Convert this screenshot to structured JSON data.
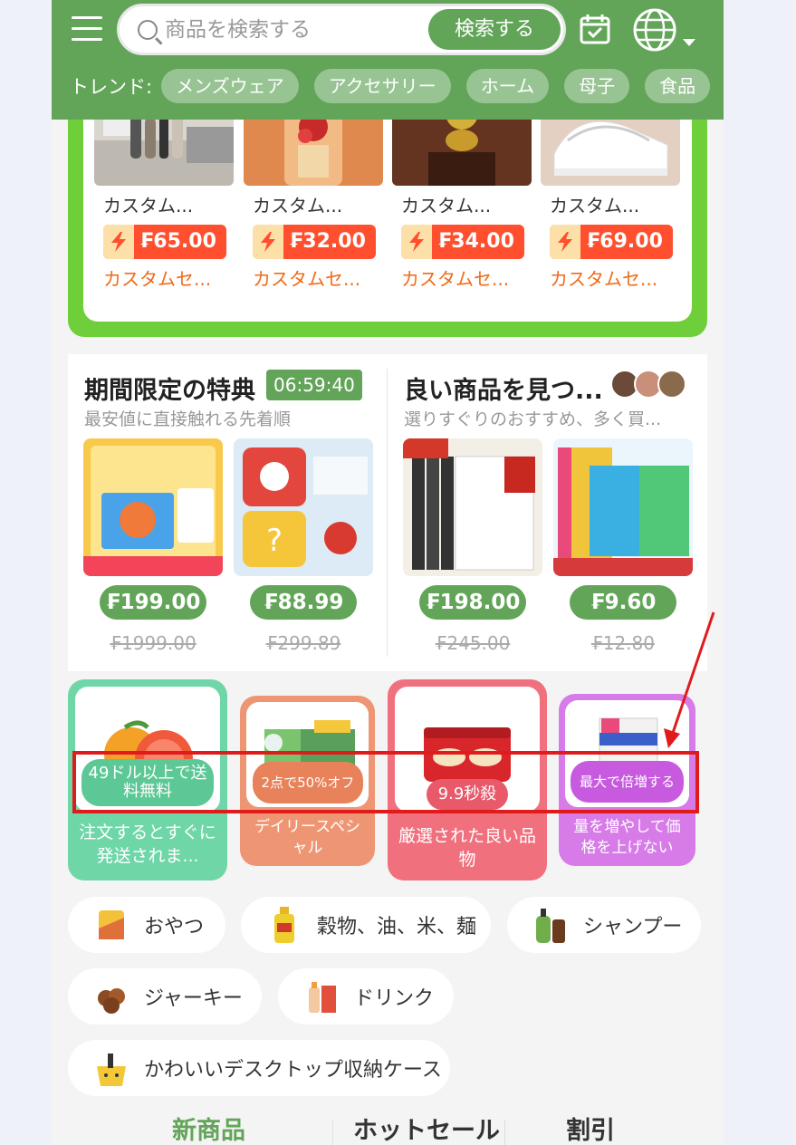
{
  "header": {
    "search_placeholder": "商品を検索する",
    "search_button": "検索する",
    "trend_label": "トレンド:",
    "trend_tags": [
      "メンズウェア",
      "アクセサリー",
      "ホーム",
      "母子",
      "食品"
    ]
  },
  "flash_products": [
    {
      "name": "カスタム...",
      "price": "₣65.00",
      "sub": "カスタムセ..."
    },
    {
      "name": "カスタム...",
      "price": "₣32.00",
      "sub": "カスタムセ..."
    },
    {
      "name": "カスタム...",
      "price": "₣34.00",
      "sub": "カスタムセ..."
    },
    {
      "name": "カスタム...",
      "price": "₣69.00",
      "sub": "カスタムセ..."
    }
  ],
  "deals": {
    "left": {
      "title": "期間限定の特典",
      "timer": "06:59:40",
      "subtitle": "最安値に直接触れる先着順",
      "products": [
        {
          "price": "₣199.00",
          "original": "₣1999.00"
        },
        {
          "price": "₣88.99",
          "original": "₣299.89"
        }
      ]
    },
    "right": {
      "title": "良い商品を見つ...",
      "subtitle": "選りすぐりのおすすめ、多く買...",
      "products": [
        {
          "price": "₣198.00",
          "original": "₣245.00"
        },
        {
          "price": "₣9.60",
          "original": "₣12.80"
        }
      ]
    }
  },
  "categories": [
    {
      "badge": "49ドル以上で送料無料",
      "text": "注文するとすぐに発送されま...",
      "color": "#6fd6a8"
    },
    {
      "badge": "2点で50%オフ",
      "text": "デイリースペシャル",
      "color": "#ee9673"
    },
    {
      "badge": "9.9秒殺",
      "text": "厳選された良い品物",
      "color": "#f0707e"
    },
    {
      "badge": "最大で倍増する",
      "text": "量を増やして価格を上げない",
      "color": "#d67be8"
    }
  ],
  "chips": [
    {
      "label": "おやつ",
      "icon": "snack-icon"
    },
    {
      "label": "穀物、油、米、麺",
      "icon": "oil-bottle-icon"
    },
    {
      "label": "シャンプー",
      "icon": "shampoo-icon"
    },
    {
      "label": "ジャーキー",
      "icon": "jerky-icon"
    },
    {
      "label": "ドリンク",
      "icon": "drink-icon"
    },
    {
      "label": "かわいいデスクトップ収納ケース",
      "icon": "storage-case-icon"
    }
  ],
  "tabs": [
    "新商品",
    "ホットセール",
    "割引"
  ],
  "colors": {
    "brand": "#62a559",
    "flash": "#ff4f2e",
    "annotation": "#e01b1b"
  }
}
